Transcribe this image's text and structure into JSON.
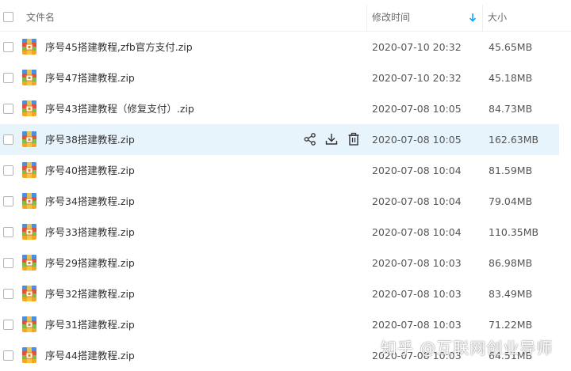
{
  "header": {
    "name_label": "文件名",
    "time_label": "修改时间",
    "size_label": "大小"
  },
  "colors": {
    "hover_row": "#e8f4fc",
    "sort_arrow": "#09aaff",
    "text": "#333333"
  },
  "hover_actions": [
    "share-icon",
    "download-icon",
    "delete-icon"
  ],
  "files": [
    {
      "name": "序号45搭建教程,zfb官方支付.zip",
      "time": "2020-07-10 20:32",
      "size": "45.65MB"
    },
    {
      "name": "序号47搭建教程.zip",
      "time": "2020-07-10 20:32",
      "size": "45.18MB"
    },
    {
      "name": "序号43搭建教程（修复支付）.zip",
      "time": "2020-07-08 10:05",
      "size": "84.73MB"
    },
    {
      "name": "序号38搭建教程.zip",
      "time": "2020-07-08 10:05",
      "size": "162.63MB"
    },
    {
      "name": "序号40搭建教程.zip",
      "time": "2020-07-08 10:04",
      "size": "81.59MB"
    },
    {
      "name": "序号34搭建教程.zip",
      "time": "2020-07-08 10:04",
      "size": "79.04MB"
    },
    {
      "name": "序号33搭建教程.zip",
      "time": "2020-07-08 10:04",
      "size": "110.35MB"
    },
    {
      "name": "序号29搭建教程.zip",
      "time": "2020-07-08 10:03",
      "size": "86.98MB"
    },
    {
      "name": "序号32搭建教程.zip",
      "time": "2020-07-08 10:03",
      "size": "83.49MB"
    },
    {
      "name": "序号31搭建教程.zip",
      "time": "2020-07-08 10:03",
      "size": "71.22MB"
    },
    {
      "name": "序号44搭建教程.zip",
      "time": "2020-07-08 10:03",
      "size": "64.51MB"
    }
  ],
  "watermark": "知乎 @互联网创业导师"
}
